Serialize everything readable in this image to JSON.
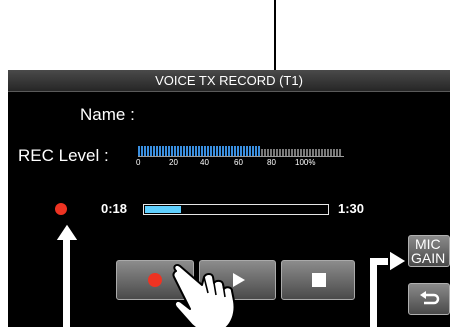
{
  "window": {
    "title": "VOICE TX RECORD  (T1)"
  },
  "labels": {
    "name": "Name :",
    "rec_level": "REC Level :"
  },
  "meter": {
    "scale": [
      "0",
      "20",
      "40",
      "60",
      "80",
      "100%"
    ],
    "level_percent": 60
  },
  "progress": {
    "elapsed": "0:18",
    "total": "1:30",
    "fraction": 0.2
  },
  "buttons": {
    "record": "record-icon",
    "play": "play-icon",
    "stop": "stop-icon",
    "mic_gain_line1": "MIC",
    "mic_gain_line2": "GAIN",
    "back": "return-icon"
  },
  "colors": {
    "record_red": "#ee3322",
    "meter_blue": "#3a8fe0",
    "progress_fill": "#5fd0ff"
  }
}
